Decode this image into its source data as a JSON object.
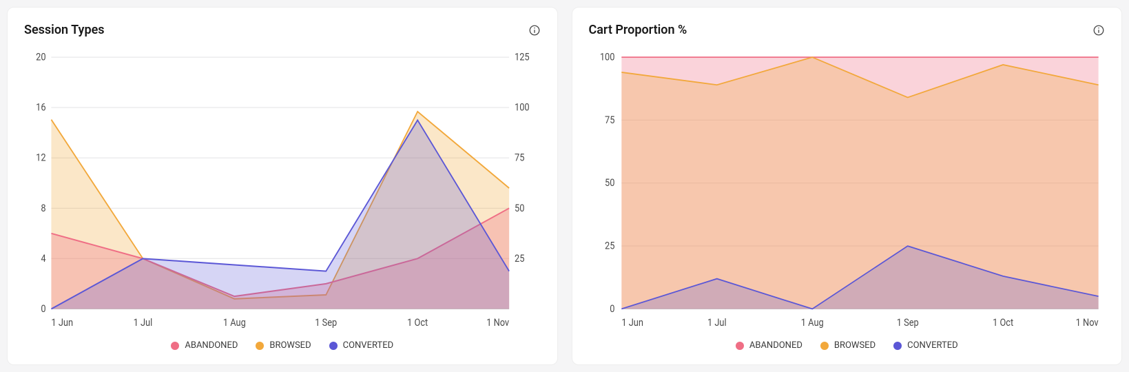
{
  "colors": {
    "abandoned": "#ef6e85",
    "abandoned_fill": "rgba(239,110,133,0.30)",
    "browsed": "#f2a83b",
    "browsed_fill": "rgba(242,168,59,0.28)",
    "converted": "#5b57d6",
    "converted_fill": "rgba(91,87,214,0.25)"
  },
  "panels": [
    {
      "id": "session_types",
      "title": "Session Types",
      "legend": [
        "ABANDONED",
        "BROWSED",
        "CONVERTED"
      ]
    },
    {
      "id": "cart_proportion",
      "title": "Cart Proportion %",
      "legend": [
        "ABANDONED",
        "BROWSED",
        "CONVERTED"
      ]
    }
  ],
  "chart_data": [
    {
      "id": "session_types",
      "type": "area",
      "title": "Session Types",
      "x": [
        "1 Jun",
        "1 Jul",
        "1 Aug",
        "1 Sep",
        "1 Oct",
        "1 Nov"
      ],
      "y_left": {
        "label": "",
        "ticks": [
          0,
          4,
          8,
          12,
          16,
          20
        ],
        "range": [
          0,
          20
        ]
      },
      "y_right": {
        "label": "",
        "ticks": [
          25,
          50,
          75,
          100,
          125
        ],
        "range": [
          0,
          125
        ]
      },
      "series": [
        {
          "name": "ABANDONED",
          "axis": "left",
          "values": [
            6,
            4,
            1,
            2,
            4,
            8
          ]
        },
        {
          "name": "BROWSED",
          "axis": "right",
          "values": [
            94,
            25,
            5,
            7,
            98,
            60
          ]
        },
        {
          "name": "CONVERTED",
          "axis": "left",
          "values": [
            0,
            4,
            3.5,
            3,
            15,
            3
          ]
        }
      ],
      "legend_position": "bottom",
      "grid": true
    },
    {
      "id": "cart_proportion",
      "type": "area",
      "title": "Cart Proportion %",
      "x": [
        "1 Jun",
        "1 Jul",
        "1 Aug",
        "1 Sep",
        "1 Oct",
        "1 Nov"
      ],
      "y_left": {
        "label": "",
        "ticks": [
          0,
          25,
          50,
          75,
          100
        ],
        "range": [
          0,
          100
        ]
      },
      "stacked": true,
      "series": [
        {
          "name": "ABANDONED",
          "values": [
            100,
            100,
            100,
            100,
            100,
            100
          ]
        },
        {
          "name": "BROWSED",
          "values": [
            94,
            89,
            100,
            84,
            97,
            89
          ]
        },
        {
          "name": "CONVERTED",
          "values": [
            0,
            12,
            0,
            25,
            13,
            5
          ]
        }
      ],
      "legend_position": "bottom",
      "grid": true
    }
  ]
}
